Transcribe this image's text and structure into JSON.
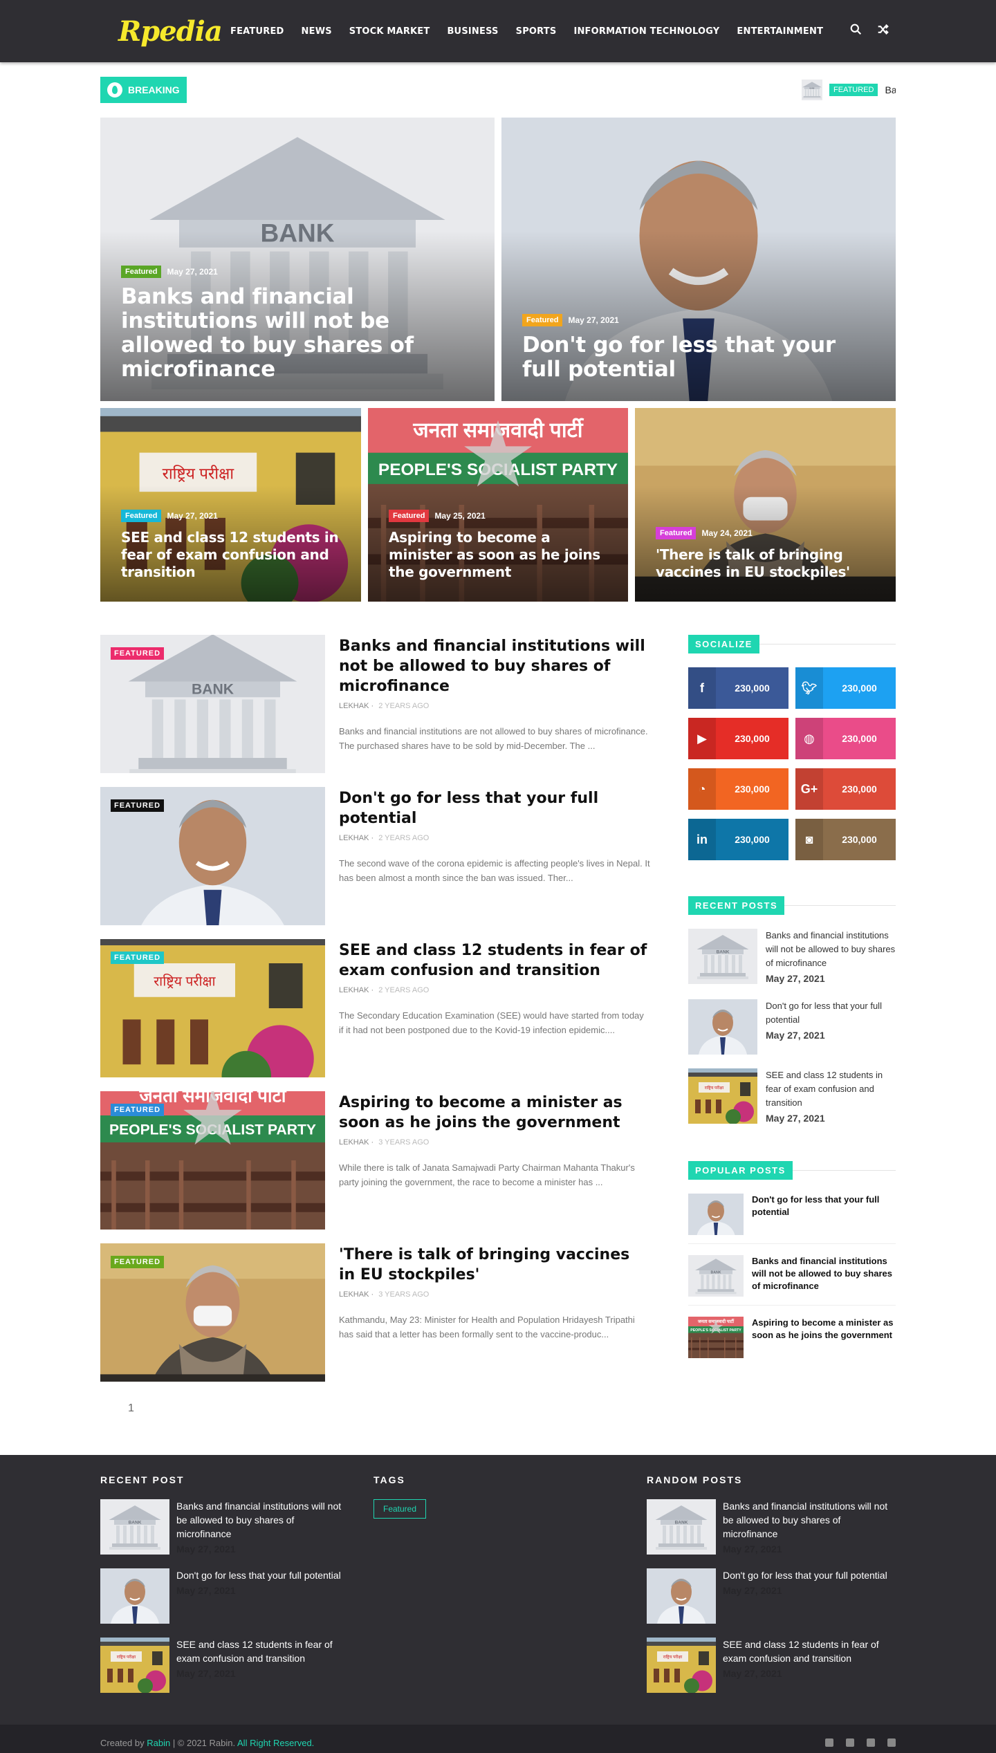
{
  "header": {
    "logo": "Rpedia",
    "nav": [
      "FEATURED",
      "NEWS",
      "STOCK MARKET",
      "BUSINESS",
      "SPORTS",
      "INFORMATION TECHNOLOGY",
      "ENTERTAINMENT"
    ]
  },
  "breaking": {
    "label": "BREAKING",
    "ticker_badge": "FEATURED",
    "ticker_text": "Banks and financial institutions will not be allowed to buy shares of microfinance"
  },
  "hero": [
    {
      "badge": "Featured",
      "badge_color": "#5aa626",
      "date": "May 27, 2021",
      "title": "Banks and financial institutions will not be allowed to buy shares of microfinance"
    },
    {
      "badge": "Featured",
      "badge_color": "#f2a51c",
      "date": "May 27, 2021",
      "title": "Don't go for less that your full potential"
    },
    {
      "badge": "Featured",
      "badge_color": "#16b8d8",
      "date": "May 27, 2021",
      "title": "SEE and class 12 students in fear of exam confusion and transition"
    },
    {
      "badge": "Featured",
      "badge_color": "#e2383f",
      "date": "May 25, 2021",
      "title": "Aspiring to become a minister as soon as he joins the government"
    },
    {
      "badge": "Featured",
      "badge_color": "#d63fd9",
      "date": "May 24, 2021",
      "title": "'There is talk of bringing vaccines in EU stockpiles'"
    }
  ],
  "posts": [
    {
      "badge": "FEATURED",
      "badge_color": "#ec2c6c",
      "title": "Banks and financial institutions will not be allowed to buy shares of microfinance",
      "author": "LEKHAK",
      "ago": "2 YEARS AGO",
      "excerpt": "  Banks and financial institutions are not allowed to buy shares of microfinance. The purchased shares have to be sold by mid-December. The ..."
    },
    {
      "badge": "FEATURED",
      "badge_color": "#111111",
      "title": "Don't go for less that your full potential",
      "author": "LEKHAK",
      "ago": "2 YEARS AGO",
      "excerpt": "  The second wave of the corona epidemic is affecting people's lives in Nepal. It has been almost a month since the ban was issued. Ther..."
    },
    {
      "badge": "FEATURED",
      "badge_color": "#1fc7c7",
      "title": "SEE and class 12 students in fear of exam confusion and transition",
      "author": "LEKHAK",
      "ago": "2 YEARS AGO",
      "excerpt": "The Secondary Education Examination (SEE) would have started from today if it had not been postponed due to the Kovid-19 infection epidemic...."
    },
    {
      "badge": "FEATURED",
      "badge_color": "#2a8cd8",
      "title": "Aspiring to become a minister as soon as he joins the government",
      "author": "LEKHAK",
      "ago": "3 YEARS AGO",
      "excerpt": "While there is talk of Janata Samajwadi Party Chairman Mahanta Thakur's party joining the government, the race to become a minister has ..."
    },
    {
      "badge": "FEATURED",
      "badge_color": "#6aa81c",
      "title": "'There is talk of bringing vaccines in EU stockpiles'",
      "author": "LEKHAK",
      "ago": "3 YEARS AGO",
      "excerpt": "Kathmandu, May 23: Minister for Health and Population Hridayesh Tripathi has said that a letter has been formally sent to the vaccine-produc..."
    }
  ],
  "pagination": "1",
  "sidebar": {
    "socialize_title": "SOCIALIZE",
    "social": [
      {
        "icon": "f",
        "count": "230,000",
        "color": "#3b5998"
      },
      {
        "icon": "t",
        "count": "230,000",
        "color": "#1da1f2"
      },
      {
        "icon": "yt",
        "count": "230,000",
        "color": "#e52d27"
      },
      {
        "icon": "dr",
        "count": "230,000",
        "color": "#ea4c89"
      },
      {
        "icon": "rss",
        "count": "230,000",
        "color": "#f26522"
      },
      {
        "icon": "G+",
        "count": "230,000",
        "color": "#dd4b39"
      },
      {
        "icon": "in",
        "count": "230,000",
        "color": "#0e76a8"
      },
      {
        "icon": "ig",
        "count": "230,000",
        "color": "#8a6d4b"
      }
    ],
    "recent_title": "RECENT POSTS",
    "recent": [
      {
        "title": "Banks and financial institutions will not be allowed to buy shares of microfinance",
        "date": "May 27, 2021"
      },
      {
        "title": "Don't go for less that your full potential",
        "date": "May 27, 2021"
      },
      {
        "title": "SEE and class 12 students in fear of exam confusion and transition",
        "date": "May 27, 2021"
      }
    ],
    "popular_title": "POPULAR POSTS",
    "popular": [
      {
        "title": "Don't go for less that your full potential"
      },
      {
        "title": "Banks and financial institutions will not be allowed to buy shares of microfinance"
      },
      {
        "title": "Aspiring to become a minister as soon as he joins the government"
      }
    ]
  },
  "footer": {
    "recent_title": "RECENT POST",
    "tags_title": "TAGS",
    "random_title": "RANDOM POSTS",
    "tag": "Featured",
    "recent": [
      {
        "title": "Banks and financial institutions will not be allowed to buy shares of microfinance",
        "date": "May 27, 2021"
      },
      {
        "title": "Don't go for less that your full potential",
        "date": "May 27, 2021"
      },
      {
        "title": "SEE and class 12 students in fear of exam confusion and transition",
        "date": "May 27, 2021"
      }
    ],
    "random": [
      {
        "title": "Banks and financial institutions will not be allowed to buy shares of microfinance",
        "date": "May 27, 2021"
      },
      {
        "title": "Don't go for less that your full potential",
        "date": "May 27, 2021"
      },
      {
        "title": "SEE and class 12 students in fear of exam confusion and transition",
        "date": "May 27, 2021"
      }
    ],
    "copy_prefix": "Created by",
    "copy_author": "Rabin",
    "copy_mid": "| © 2021 Rabin.",
    "copy_rights": "All Right Reserved."
  }
}
